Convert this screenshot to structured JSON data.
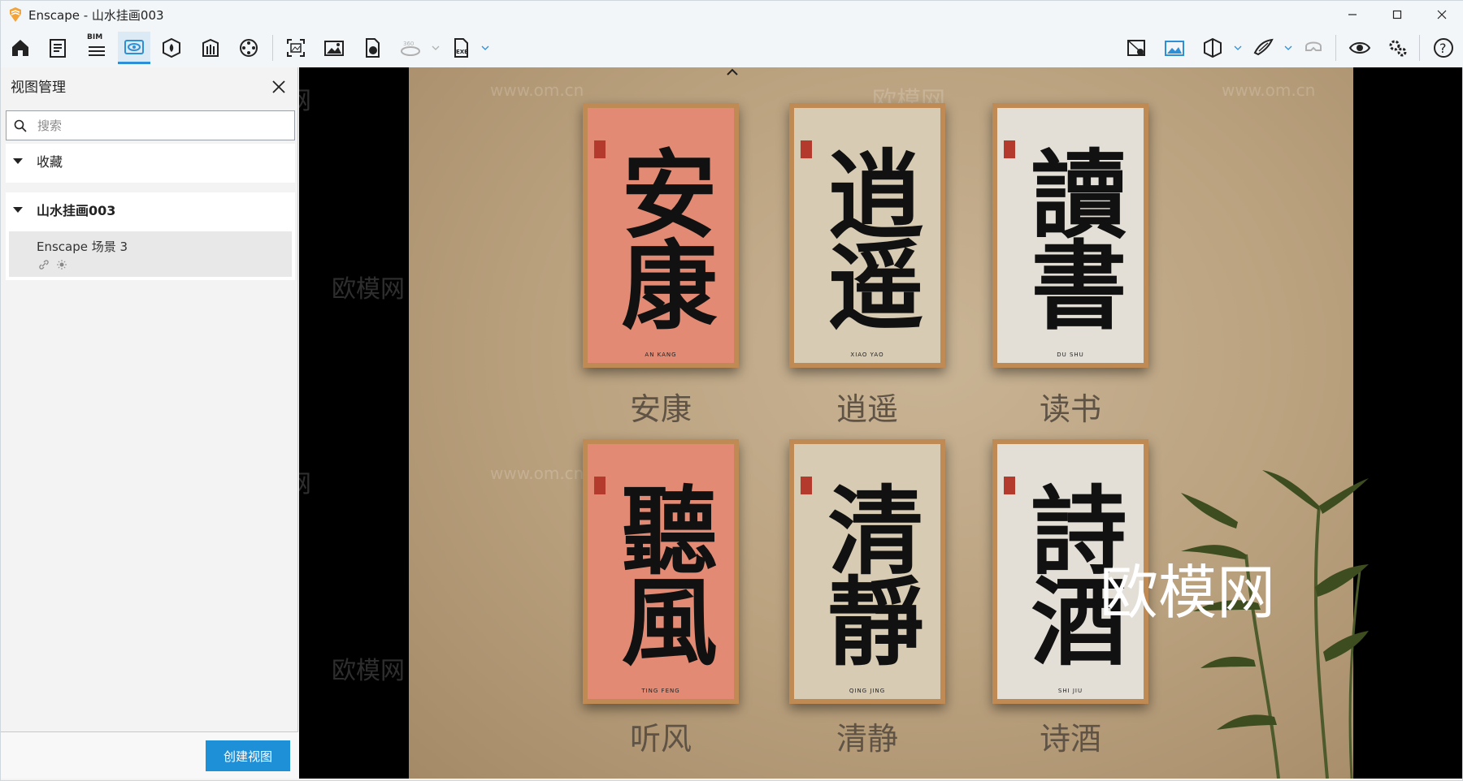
{
  "window": {
    "title": "Enscape - 山水挂画003",
    "controls": [
      "minimize-icon",
      "maximize-icon",
      "close-icon"
    ]
  },
  "toolbar": {
    "bim_label": "BIM",
    "active": "views-icon",
    "accent": "#2d8fd5"
  },
  "sidebar": {
    "title": "视图管理",
    "search_placeholder": "搜索",
    "favorites_label": "收藏",
    "project_label": "山水挂画003",
    "view_name": "Enscape 场景 3",
    "create_button": "创建视图",
    "create_button_color": "#1e90d8"
  },
  "scene": {
    "frames": [
      {
        "chars": "安康",
        "caption": "安康",
        "pinyin": "AN KANG"
      },
      {
        "chars": "逍遥",
        "caption": "逍遥",
        "pinyin": "XIAO YAO"
      },
      {
        "chars": "讀書",
        "caption": "读书",
        "pinyin": "DU SHU"
      },
      {
        "chars": "聽風",
        "caption": "听风",
        "pinyin": "TING FENG"
      },
      {
        "chars": "清靜",
        "caption": "清静",
        "pinyin": "QING JING"
      },
      {
        "chars": "詩酒",
        "caption": "诗酒",
        "pinyin": "SHI JIU"
      }
    ],
    "logo_text": "欧模网",
    "watermark_text": "欧模网",
    "watermark_url": "www.om.cn"
  }
}
